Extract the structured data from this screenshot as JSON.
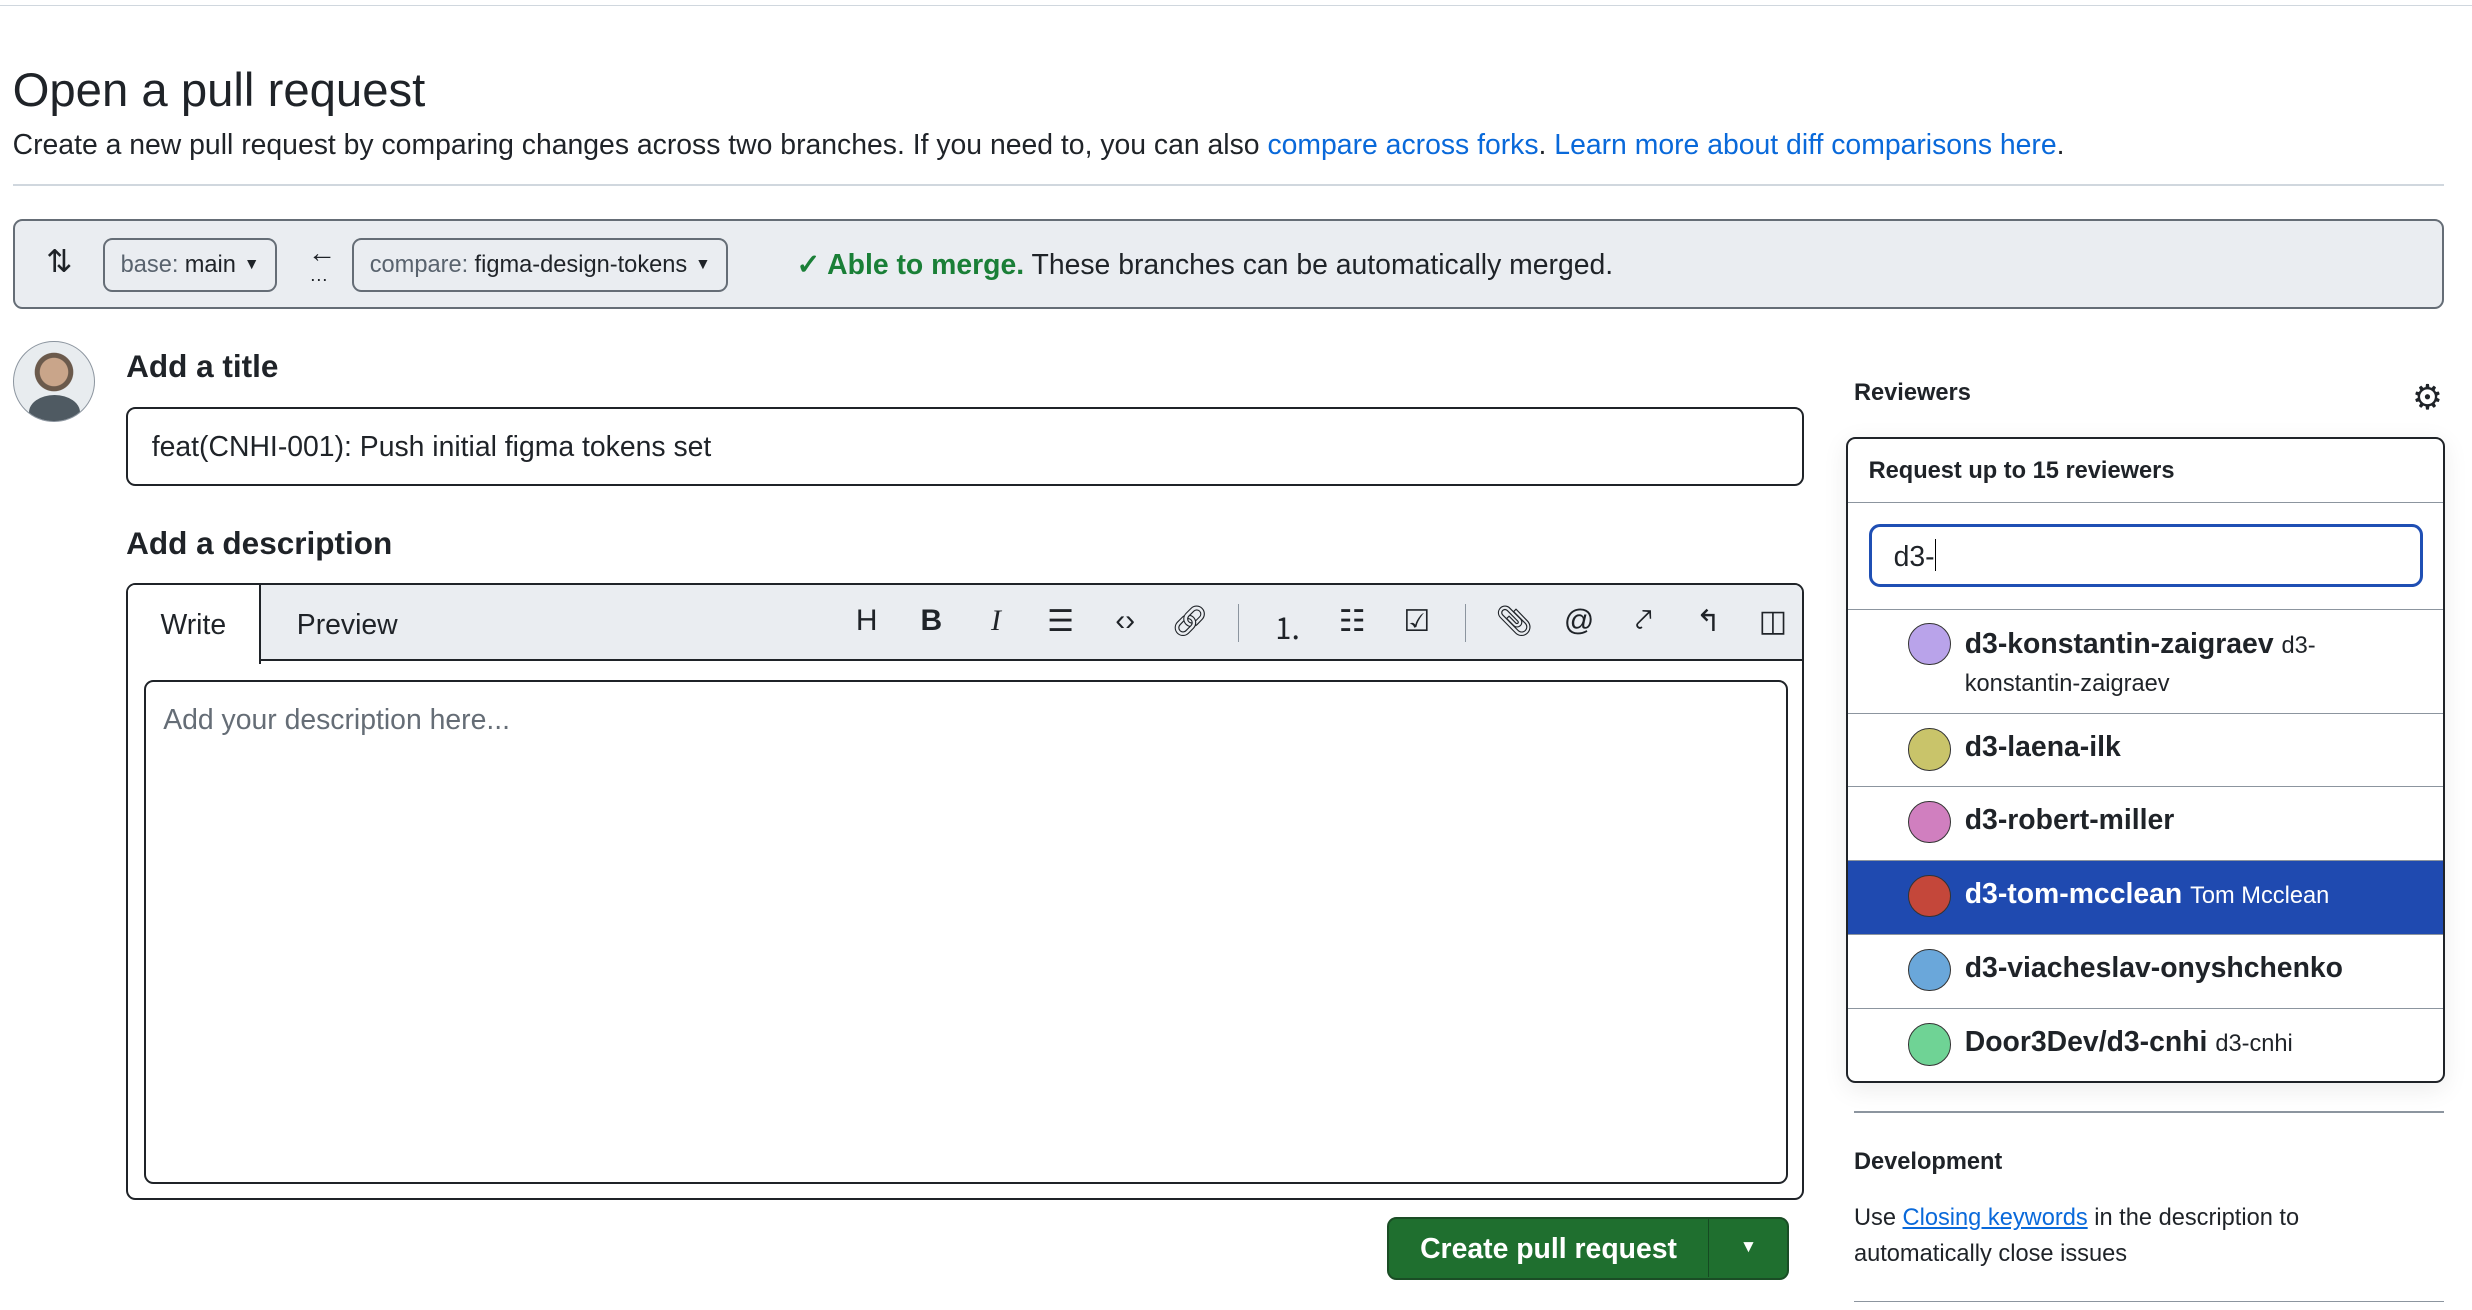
{
  "page": {
    "title": "Open a pull request",
    "subtitle_prefix": "Create a new pull request by comparing changes across two branches. If you need to, you can also ",
    "link_forks": "compare across forks",
    "sep": ". ",
    "link_learn": "Learn more about diff comparisons here",
    "suffix": "."
  },
  "compare": {
    "base_label": "base:",
    "base_value": "main",
    "compare_label": "compare:",
    "compare_value": "figma-design-tokens",
    "merge_ok": "Able to merge.",
    "merge_text": " These branches can be automatically merged.",
    "merge_color": "#1a7f37"
  },
  "form": {
    "title_label": "Add a title",
    "title_value": "feat(CNHI-001): Push initial figma tokens set",
    "desc_label": "Add a description",
    "tab_write": "Write",
    "tab_preview": "Preview",
    "desc_placeholder": "Add your description here...",
    "create_label": "Create pull request",
    "toolbar": [
      "heading-icon",
      "bold-icon",
      "italic-icon",
      "quote-icon",
      "code-icon",
      "link-icon",
      "numbered-list-icon",
      "unordered-list-icon",
      "task-list-icon",
      "attach-icon",
      "mention-icon",
      "cross-reference-icon",
      "reply-icon",
      "slash-commands-icon"
    ]
  },
  "sidebar": {
    "reviewers_label": "Reviewers",
    "dropdown_title": "Request up to 15 reviewers",
    "search_value": "d3-",
    "reviewers": [
      {
        "login": "d3-konstantin-zaigraev",
        "name": "d3-konstantin-zaigraev",
        "color": "#b9a3ea"
      },
      {
        "login": "d3-laena-ilk",
        "name": "",
        "color": "#c9c46a"
      },
      {
        "login": "d3-robert-miller",
        "name": "",
        "color": "#d07fbf"
      },
      {
        "login": "d3-tom-mcclean",
        "name": "Tom Mcclean",
        "color": "#c4473a"
      },
      {
        "login": "d3-viacheslav-onyshchenko",
        "name": "",
        "color": "#6aa7da"
      },
      {
        "login": "Door3Dev/d3-cnhi",
        "name": "d3-cnhi",
        "color": "#6fd395"
      }
    ],
    "selected_color": "#1f4ab0",
    "development_label": "Development",
    "dev_prefix": "Use ",
    "dev_link": "Closing keywords",
    "dev_suffix": " in the description to automatically close issues"
  }
}
